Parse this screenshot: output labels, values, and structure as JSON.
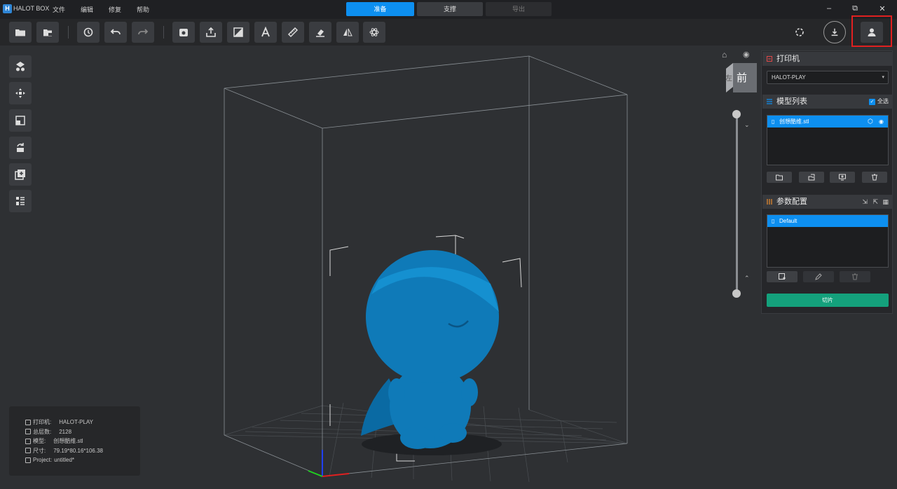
{
  "app": {
    "name": "HALOT BOX",
    "logo_letter": "H"
  },
  "menu": [
    "文件",
    "编辑",
    "修复",
    "帮助"
  ],
  "mode_tabs": [
    {
      "label": "准备",
      "active": true
    },
    {
      "label": "支撑",
      "active": false
    },
    {
      "label": "导出",
      "active": false
    }
  ],
  "toolbar": {
    "left_icons": [
      "open-folder-icon",
      "import-icon",
      "history-icon",
      "undo-icon",
      "redo-icon",
      "hollow-icon",
      "export-icon",
      "support-icon",
      "text-icon",
      "ruler-icon",
      "erase-icon",
      "mirror-icon",
      "atom-icon"
    ],
    "right_icons": [
      "repair-ring-icon",
      "download-icon",
      "user-icon"
    ]
  },
  "left_tools": [
    "arrange-icon",
    "move-icon",
    "scale-icon",
    "rotate-icon",
    "duplicate-icon",
    "list-icon"
  ],
  "view_cube": {
    "front_label": "前",
    "left_label": "左"
  },
  "printer_section": {
    "title": "打印机",
    "selected": "HALOT-PLAY"
  },
  "model_section": {
    "title": "模型列表",
    "select_all_label": "全选",
    "select_all_checked": true,
    "items": [
      {
        "name": "创想酷维.stl"
      }
    ]
  },
  "param_section": {
    "title": "参数配置",
    "items": [
      {
        "name": "Default"
      }
    ]
  },
  "slice_button": "切片",
  "info": {
    "rows": [
      {
        "key": "打印机:",
        "value": "HALOT-PLAY"
      },
      {
        "key": "总层数:",
        "value": "2128"
      },
      {
        "key": "模型:",
        "value": "创想酷维.stl"
      },
      {
        "key": "尺寸:",
        "value": "79.19*80.16*106.38"
      },
      {
        "key": "Project:",
        "value": "untitled*"
      }
    ]
  },
  "colors": {
    "accent": "#0d8ff0",
    "slice": "#14a17c",
    "model": "#0f7ab8",
    "highlight": "#e02020"
  }
}
